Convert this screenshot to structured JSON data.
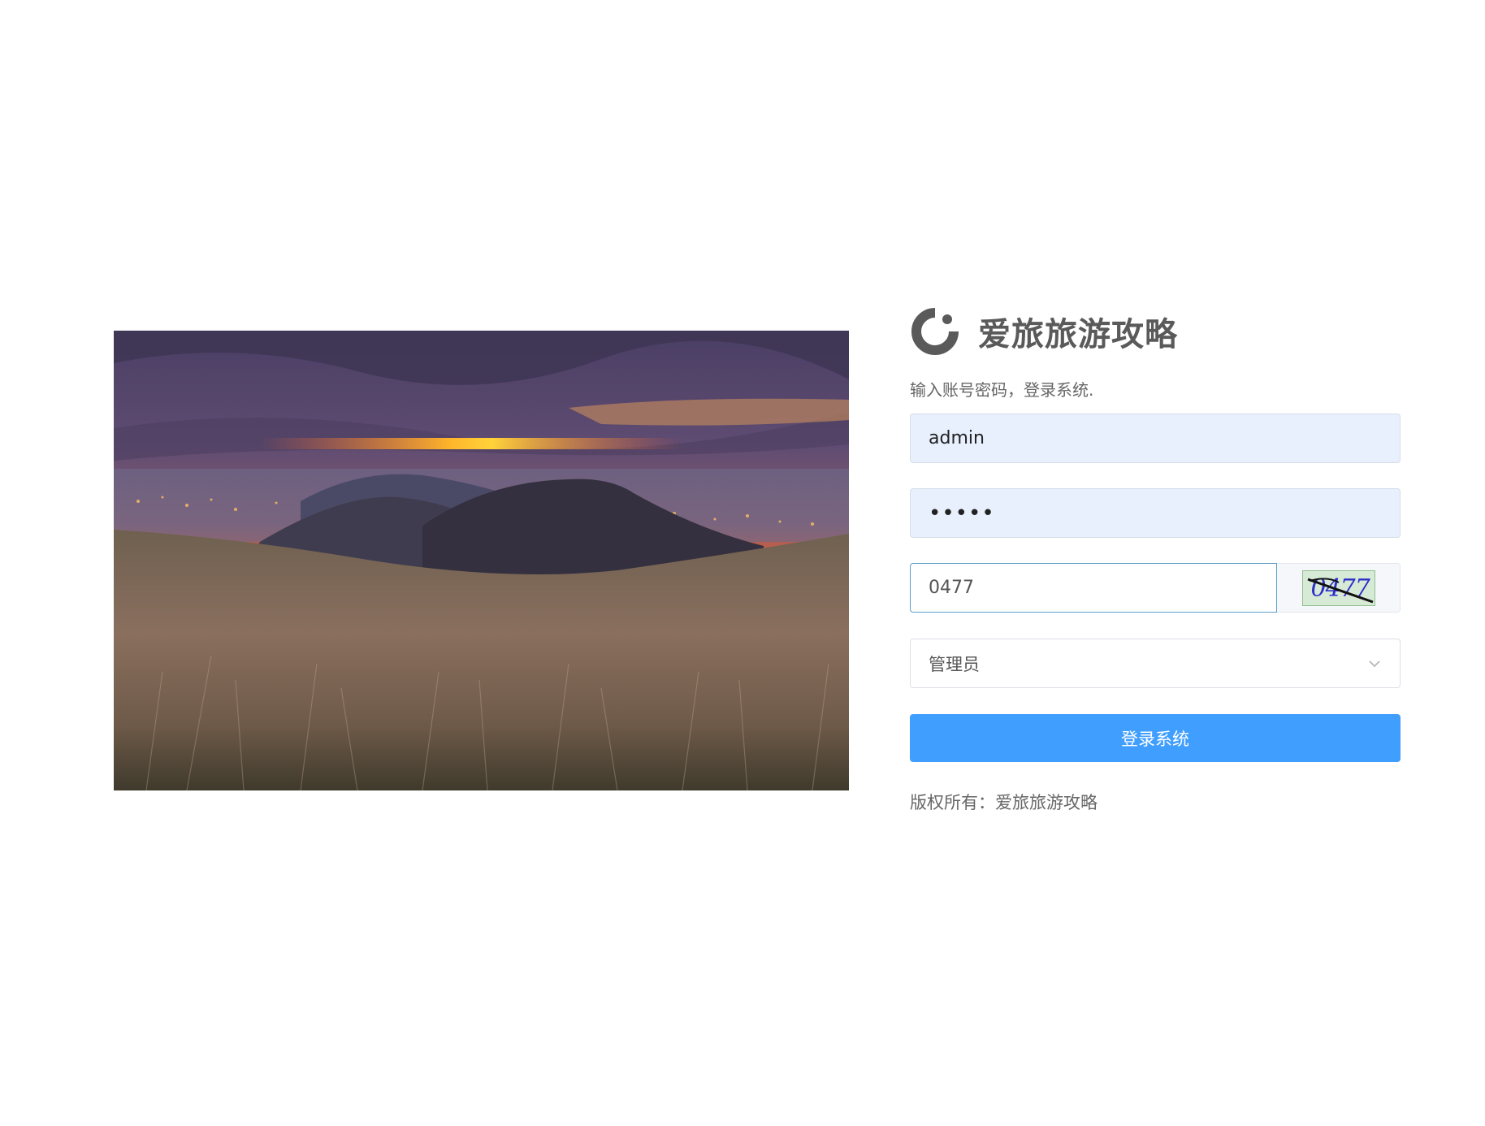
{
  "brand": {
    "title": "爱旅旅游攻略",
    "logo_icon": "refresh-circle-icon"
  },
  "subtitle": "输入账号密码，登录系统.",
  "form": {
    "username": {
      "value": "admin"
    },
    "password": {
      "value": "•••••"
    },
    "captcha": {
      "value": "0477",
      "image_text": "0477"
    },
    "role": {
      "value": "管理员",
      "icon": "chevron-down-icon"
    },
    "submit_label": "登录系统"
  },
  "copyright": "版权所有：爱旅旅游攻略",
  "colors": {
    "primary": "#409eff",
    "autofill_bg": "#e8f0fe",
    "title": "#5a5a5a"
  }
}
